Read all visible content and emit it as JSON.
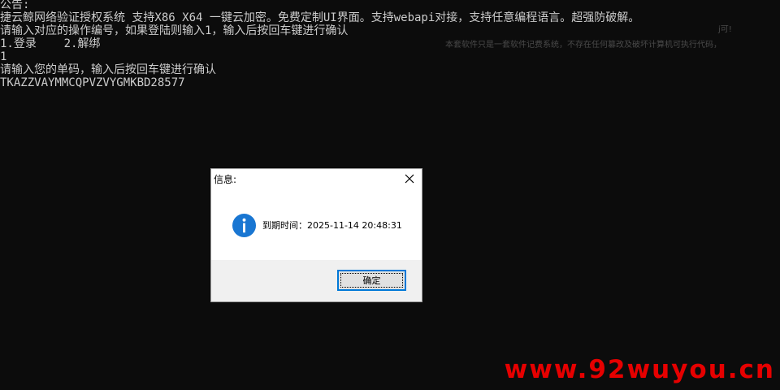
{
  "console": {
    "lines": [
      "公告:",
      "捷云鲸网络验证授权系统 支持X86 X64 一键云加密。免费定制UI界面。支持webapi对接，支持任意编程语言。超强防破解。",
      "请输入对应的操作编号，如果登陆则输入1，输入后按回车键进行确认",
      "1.登录    2.解绑",
      "1",
      "请输入您的单码，输入后按回车键进行确认",
      "TKAZZVAYMMCQPVZVYGMKBD28577"
    ],
    "ghost_top": "j可!",
    "ghost_right": "本套软件只是一套软件记费系统，不存在任何篡改及破坏计算机可执行代码，"
  },
  "dialog": {
    "title": "信息:",
    "icon": "info-icon",
    "message": "到期时间：2025-11-14 20:48:31",
    "ok_label": "确定"
  },
  "watermark": {
    "text": "www.92wuyou.cn",
    "color": "#e60000"
  },
  "colors": {
    "console_bg": "#0c0c0c",
    "console_text": "#cccccc",
    "accent": "#0078d7"
  }
}
